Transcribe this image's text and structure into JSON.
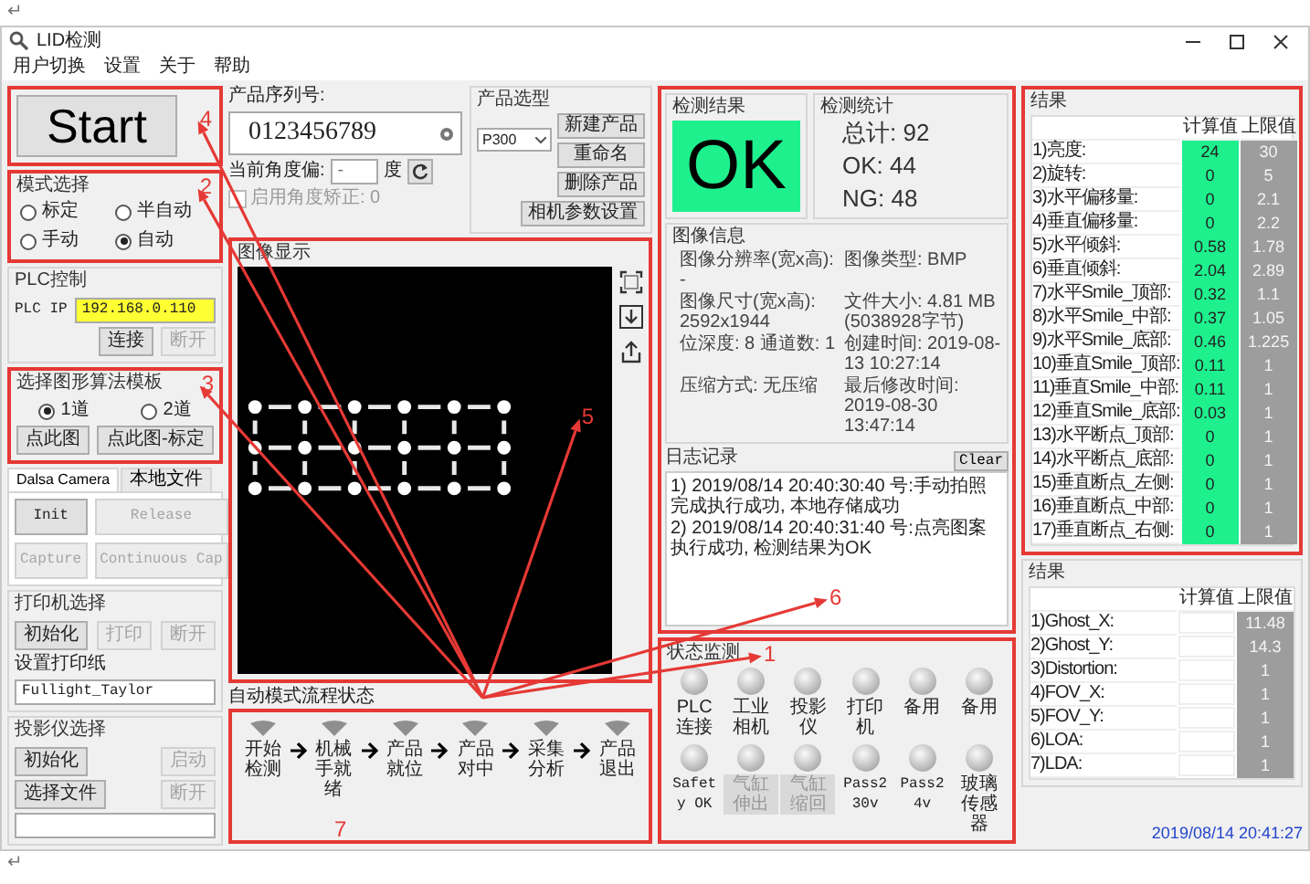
{
  "marks": [
    "↵",
    "↵"
  ],
  "window": {
    "title": "LID检测"
  },
  "menu": [
    {
      "label": "用户切换"
    },
    {
      "label": "设置"
    },
    {
      "label": "关于"
    },
    {
      "label": "帮助"
    }
  ],
  "start": {
    "label": "Start",
    "highlight": true,
    "callout": {
      "number": "4",
      "arrow": true
    }
  },
  "mode": {
    "title": "模式选择",
    "highlight": true,
    "callout": {
      "number": "2",
      "arrow": true
    },
    "options": [
      {
        "label": "标定",
        "selected": false
      },
      {
        "label": "半自动",
        "selected": false
      },
      {
        "label": "手动",
        "selected": false
      },
      {
        "label": "自动",
        "selected": true
      }
    ]
  },
  "plc": {
    "title": "PLC控制",
    "ip_label": "PLC IP",
    "ip_value": "192.168.0.110",
    "buttons": [
      {
        "label": "连接",
        "disabled": false
      },
      {
        "label": "断开",
        "disabled": true
      }
    ]
  },
  "template": {
    "title": "选择图形算法模板",
    "highlight": true,
    "callout": {
      "number": "3",
      "arrow": true
    },
    "options": [
      {
        "label": "1道",
        "selected": true
      },
      {
        "label": "2道",
        "selected": false
      }
    ],
    "buttons": [
      {
        "label": "点此图",
        "disabled": false
      },
      {
        "label": "点此图-标定",
        "disabled": false
      }
    ]
  },
  "camera": {
    "tabs": [
      {
        "label": "Dalsa Camera",
        "selected": true
      },
      {
        "label": "本地文件",
        "selected": false
      }
    ],
    "buttons": [
      {
        "label": "Init",
        "disabled": false
      },
      {
        "label": "Release",
        "disabled": true
      },
      {
        "label": "Capture",
        "disabled": true
      },
      {
        "label": "Continuous Cap",
        "disabled": true
      }
    ]
  },
  "printer": {
    "title": "打印机选择",
    "buttons": [
      {
        "label": "初始化",
        "disabled": false
      },
      {
        "label": "打印",
        "disabled": true
      },
      {
        "label": "断开",
        "disabled": true
      }
    ],
    "path_label": "设置打印纸",
    "path_value": "Fullight_Taylor"
  },
  "projector": {
    "title": "投影仪选择",
    "buttons": [
      {
        "label": "初始化",
        "disabled": false
      },
      {
        "label": "启动",
        "disabled": true
      },
      {
        "label": "断开",
        "disabled": true
      }
    ],
    "file_button": "选择文件"
  },
  "product": {
    "serial_label": "产品序列号:",
    "serial_value": "0123456789",
    "angle_label": "当前角度偏:",
    "angle_value": "-",
    "angle_unit": "度",
    "correction": {
      "label": "启用角度矫正: 0",
      "checked": false
    }
  },
  "product_type": {
    "title": "产品选型",
    "value": "P300",
    "buttons": [
      {
        "label": "新建产品"
      },
      {
        "label": "重命名"
      },
      {
        "label": "删除产品"
      }
    ],
    "save_button": "相机参数设置"
  },
  "image_panel": {
    "title": "图像显示",
    "highlight": true,
    "callout": {
      "number": "5",
      "arrow": true
    }
  },
  "flow": {
    "title": "自动模式流程状态",
    "highlight": true,
    "callout": {
      "number": "7",
      "arrow": false
    },
    "steps": [
      {
        "label": "开始检测"
      },
      {
        "label": "机械手就绪"
      },
      {
        "label": "产品就位"
      },
      {
        "label": "产品对中"
      },
      {
        "label": "采集分析"
      },
      {
        "label": "产品退出"
      }
    ]
  },
  "inspection": {
    "highlight": true,
    "callout": {
      "number": "6",
      "arrow": true
    },
    "result": {
      "title": "检测结果",
      "value": "OK",
      "passed": true
    },
    "stats": {
      "title": "检测统计",
      "rows": [
        {
          "label": "总计:",
          "value": "92"
        },
        {
          "label": "OK:",
          "value": "44"
        },
        {
          "label": "NG:",
          "value": "48"
        }
      ]
    },
    "image_info": {
      "title": "图像信息",
      "items": [
        "图像分辨率(宽x高): -",
        "图像类型: BMP",
        "图像尺寸(宽x高): 2592x1944",
        "文件大小: 4.81 MB (5038928字节)",
        "位深度: 8   通道数: 1",
        "创建时间: 2019-08-13 10:27:14",
        "压缩方式: 无压缩",
        "最后修改时间: 2019-08-30 13:47:14"
      ]
    },
    "log": {
      "title": "日志记录",
      "clear_button": "Clear",
      "lines": [
        "1) 2019/08/14 20:40:30:40 号:手动拍照完成执行成功, 本地存储成功",
        "2) 2019/08/14 20:40:31:40 号:点亮图案执行成功, 检测结果为OK"
      ]
    }
  },
  "status_monitor": {
    "title": "状态监测",
    "highlight": true,
    "callout": {
      "number": "1",
      "arrow": true
    },
    "lamps": [
      {
        "label": "PLC连接",
        "disabled": false
      },
      {
        "label": "工业相机",
        "disabled": false
      },
      {
        "label": "投影仪",
        "disabled": false
      },
      {
        "label": "打印机",
        "disabled": false
      },
      {
        "label": "备用",
        "disabled": false
      },
      {
        "label": "备用",
        "disabled": false
      },
      {
        "label": "Safety OK",
        "disabled": false
      },
      {
        "label": "气缸伸出",
        "disabled": true
      },
      {
        "label": "气缸缩回",
        "disabled": true
      },
      {
        "label": "Pass230v",
        "disabled": false
      },
      {
        "label": "Pass24v",
        "disabled": false
      },
      {
        "label": "玻璃传感器",
        "disabled": false
      }
    ]
  },
  "results_table": {
    "title": "结果",
    "highlight": true,
    "columns": [
      "计算值",
      "上限值"
    ],
    "rows": [
      {
        "label": "1)亮度:",
        "value": "24",
        "limit": "30"
      },
      {
        "label": "2)旋转:",
        "value": "0",
        "limit": "5"
      },
      {
        "label": "3)水平偏移量:",
        "value": "0",
        "limit": "2.1"
      },
      {
        "label": "4)垂直偏移量:",
        "value": "0",
        "limit": "2.2"
      },
      {
        "label": "5)水平倾斜:",
        "value": "0.58",
        "limit": "1.78"
      },
      {
        "label": "6)垂直倾斜:",
        "value": "2.04",
        "limit": "2.89"
      },
      {
        "label": "7)水平Smile_顶部:",
        "value": "0.32",
        "limit": "1.1"
      },
      {
        "label": "8)水平Smile_中部:",
        "value": "0.37",
        "limit": "1.05"
      },
      {
        "label": "9)水平Smile_底部:",
        "value": "0.46",
        "limit": "1.225"
      },
      {
        "label": "10)垂直Smile_顶部:",
        "value": "0.11",
        "limit": "1"
      },
      {
        "label": "11)垂直Smile_中部:",
        "value": "0.11",
        "limit": "1"
      },
      {
        "label": "12)垂直Smile_底部:",
        "value": "0.03",
        "limit": "1"
      },
      {
        "label": "13)水平断点_顶部:",
        "value": "0",
        "limit": "1"
      },
      {
        "label": "14)水平断点_底部:",
        "value": "0",
        "limit": "1"
      },
      {
        "label": "15)垂直断点_左侧:",
        "value": "0",
        "limit": "1"
      },
      {
        "label": "16)垂直断点_中部:",
        "value": "0",
        "limit": "1"
      },
      {
        "label": "17)垂直断点_右侧:",
        "value": "0",
        "limit": "1"
      }
    ]
  },
  "second_table": {
    "title": "结果",
    "highlight": false,
    "columns": [
      "计算值",
      "上限值"
    ],
    "rows": [
      {
        "label": "1)Ghost_X:",
        "limit": "11.48"
      },
      {
        "label": "2)Ghost_Y:",
        "limit": "14.3"
      },
      {
        "label": "3)Distortion:",
        "limit": "1"
      },
      {
        "label": "4)FOV_X:",
        "limit": "1"
      },
      {
        "label": "5)FOV_Y:",
        "limit": "1"
      },
      {
        "label": "6)LOA:",
        "limit": "1"
      },
      {
        "label": "7)LDA:",
        "limit": "1"
      }
    ]
  },
  "timestamp": "2019/08/14 20:41:27"
}
